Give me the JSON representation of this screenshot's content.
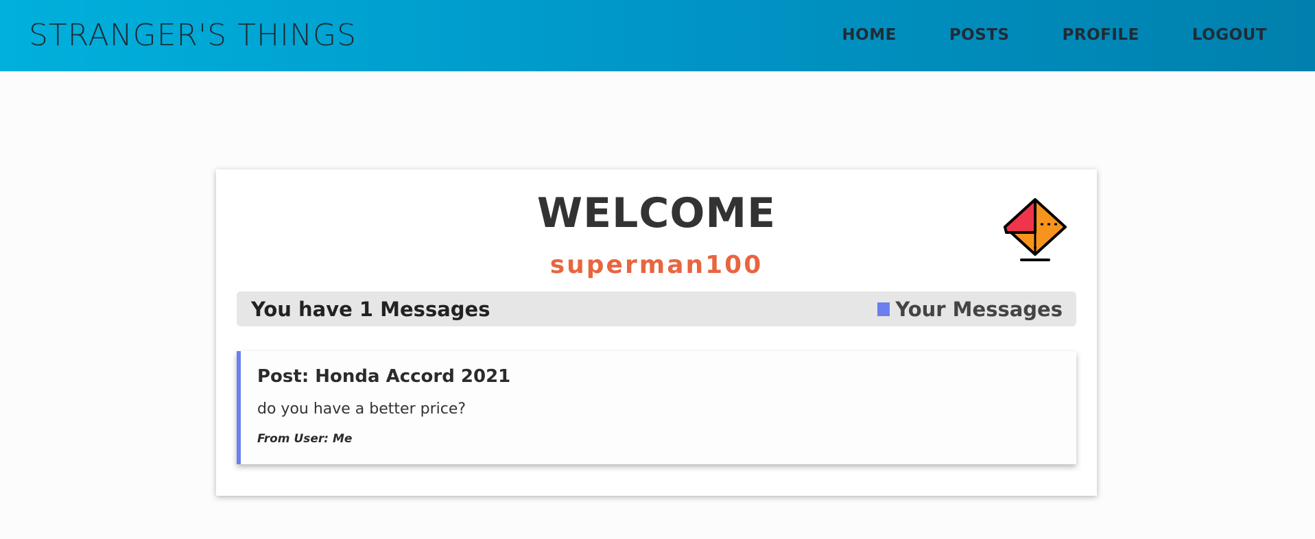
{
  "navbar": {
    "brand": "STRANGER'S THINGS",
    "links": [
      {
        "label": "HOME"
      },
      {
        "label": "POSTS"
      },
      {
        "label": "PROFILE"
      },
      {
        "label": "LOGOUT"
      }
    ],
    "gradient_start": "#01b0dc",
    "gradient_end": "#0080ad"
  },
  "profile": {
    "heading": "WELCOME",
    "username": "superman100",
    "username_color": "#e8653f",
    "icon": "mail-envelope-icon",
    "message_bar": {
      "count_text": "You have 1 Messages",
      "toggle_label": "Your Messages",
      "toggle_icon": "blue-square-icon",
      "accent": "#6b7ff0"
    },
    "messages": [
      {
        "post_title": "Post: Honda Accord 2021",
        "content": "do you have a better price?",
        "from": "From User: Me"
      }
    ]
  }
}
